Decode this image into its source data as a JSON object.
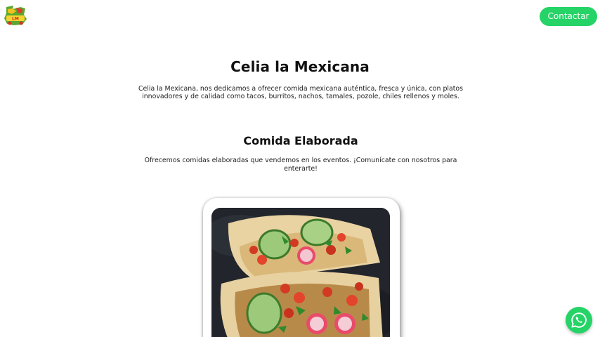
{
  "header": {
    "logo": {
      "icon": "celia-la-mexicana-logo",
      "alt_text": "Celia la Mexicana"
    },
    "contact_label": "Contactar",
    "accent_color": "#25d366"
  },
  "hero": {
    "title": "Celia la Mexicana",
    "description": "Celia la Mexicana, nos dedicamos a ofrecer comida mexicana auténtica, fresca y única, con platos innovadores y de calidad como tacos, burritos, nachos, tamales, pozole, chiles rellenos y moles."
  },
  "section": {
    "title": "Comida Elaborada",
    "description": "Ofrecemos comidas elaboradas que vendemos en los eventos. ¡Comunícate con nosotros para enterarte!",
    "image": {
      "icon": "tacos-photo"
    }
  },
  "floating": {
    "whatsapp_icon": "whatsapp-icon"
  }
}
